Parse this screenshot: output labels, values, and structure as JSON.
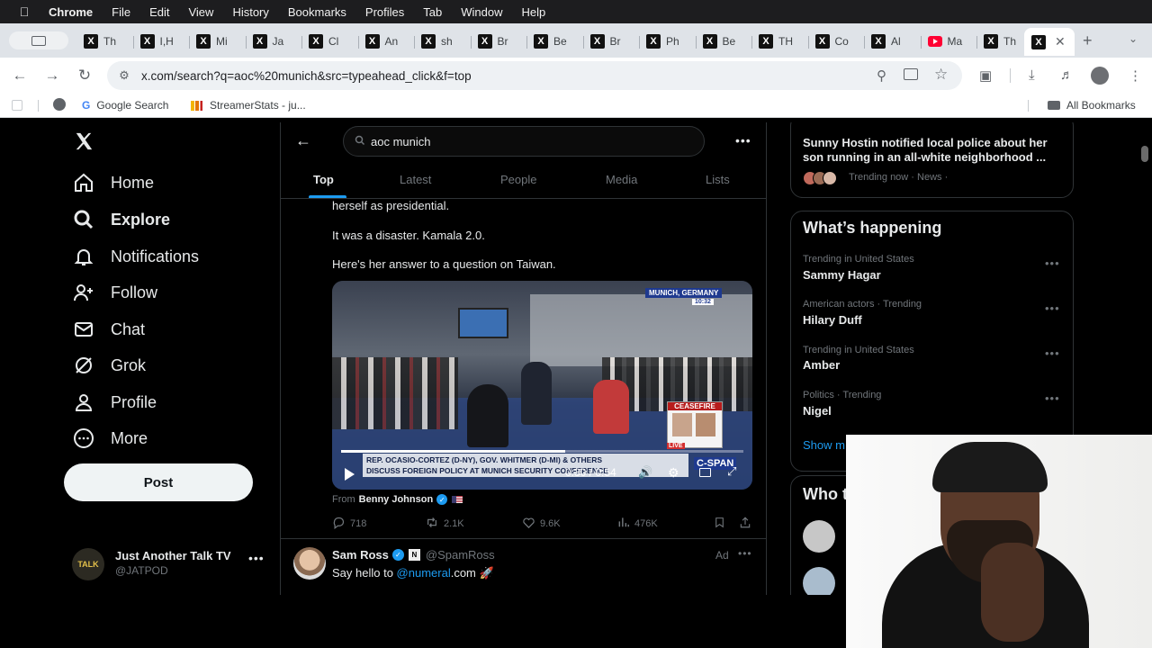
{
  "menubar": {
    "app": "Chrome",
    "items": [
      "File",
      "Edit",
      "View",
      "History",
      "Bookmarks",
      "Profiles",
      "Tab",
      "Window",
      "Help"
    ]
  },
  "tabs": {
    "titles": [
      "Th",
      "I,H",
      "Mi",
      "Ja",
      "Cl",
      "An",
      "sh",
      "Br",
      "Be",
      "Br",
      "Ph",
      "Be",
      "TH",
      "Co",
      "Al",
      "Ma",
      "Th"
    ],
    "active_icon": "X"
  },
  "toolbar": {
    "url": "x.com/search?q=aoc%20munich&src=typeahead_click&f=top"
  },
  "bookmarks": {
    "items": [
      "Google Search",
      "StreamerStats - ju..."
    ],
    "all": "All Bookmarks"
  },
  "nav": {
    "items": [
      "Home",
      "Explore",
      "Notifications",
      "Follow",
      "Chat",
      "Grok",
      "Profile",
      "More"
    ],
    "post_label": "Post"
  },
  "account": {
    "name": "Just Another Talk TV",
    "handle": "@JATPOD",
    "avatar_text": "TALK"
  },
  "search": {
    "query": "aoc munich",
    "tabs": [
      "Top",
      "Latest",
      "People",
      "Media",
      "Lists"
    ]
  },
  "post": {
    "lines": [
      "herself as presidential.",
      "It was a disaster. Kamala 2.0.",
      "Here's her answer to a question on Taiwan."
    ],
    "video": {
      "location": "MUNICH, GERMANY",
      "clock": "10:32",
      "chyron_line1": "REP. OCASIO-CORTEZ (D-NY), GOV. WHITMER (D-MI) & OTHERS",
      "chyron_line2": "DISCUSS FOREIGN POLICY AT MUNICH SECURITY CONFERENCE",
      "ceasefire": "CEASEFIRE",
      "live": "LIVE",
      "network": "C-SPAN",
      "time": "0:30 / 0:54",
      "progress": 0.556
    },
    "from_label": "From",
    "from_name": "Benny Johnson",
    "replies": "718",
    "reposts": "2.1K",
    "likes": "9.6K",
    "views": "476K"
  },
  "ad": {
    "name": "Sam Ross",
    "handle": "@SpamRoss",
    "badge": "Ad",
    "text_prefix": "Say hello to ",
    "mention": "@numeral",
    "text_suffix": ".com 🚀"
  },
  "right": {
    "news_headline": "Sunny Hostin notified local police about her son running in an all-white neighborhood ...",
    "news_meta": "Trending now · News ·",
    "whats_happening": "What’s happening",
    "trends": [
      {
        "context": "Trending in United States",
        "name": "Sammy Hagar"
      },
      {
        "context": "American actors · Trending",
        "name": "Hilary Duff"
      },
      {
        "context": "Trending in United States",
        "name": "Amber"
      },
      {
        "context": "Politics · Trending",
        "name": "Nigel"
      }
    ],
    "show_more": "Show m",
    "who_to_follow": "Who t"
  },
  "colors": {
    "accent": "#1d9bf0",
    "background": "#000000",
    "border": "#2f3336",
    "muted": "#71767b"
  }
}
